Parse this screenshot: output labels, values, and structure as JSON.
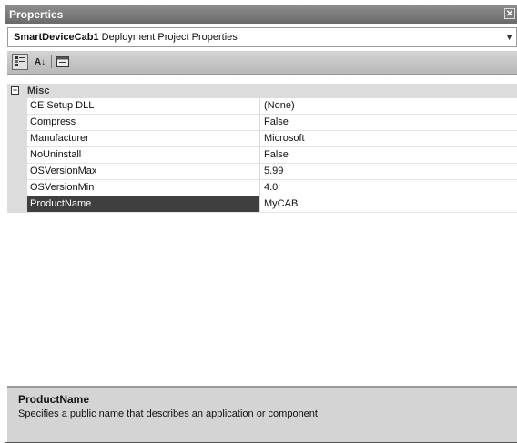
{
  "window": {
    "title": "Properties",
    "close_glyph": "✕"
  },
  "object_selector": {
    "name": "SmartDeviceCab1",
    "type": "Deployment Project Properties"
  },
  "toolbar": {
    "buttons": [
      {
        "id": "categorized",
        "icon": "categorized-icon"
      },
      {
        "id": "alphabetical",
        "icon": "sort-az-icon",
        "glyph": "A↓"
      },
      {
        "id": "property-pages",
        "icon": "property-pages-icon"
      }
    ]
  },
  "grid": {
    "category": {
      "label": "Misc",
      "toggle": "−"
    },
    "properties": [
      {
        "name": "CE Setup DLL",
        "value": "(None)"
      },
      {
        "name": "Compress",
        "value": "False"
      },
      {
        "name": "Manufacturer",
        "value": "Microsoft"
      },
      {
        "name": "NoUninstall",
        "value": "False"
      },
      {
        "name": "OSVersionMax",
        "value": "5.99"
      },
      {
        "name": "OSVersionMin",
        "value": "4.0"
      },
      {
        "name": "ProductName",
        "value": "MyCAB",
        "selected": true
      }
    ]
  },
  "description": {
    "title": "ProductName",
    "text": "Specifies a public name that describes an application or component"
  },
  "colors": {
    "titlebar": "#7a7a7a",
    "selected_row": "#3f3f3f",
    "category_bg": "#dcdcdc",
    "desc_bg": "#d4d4d4"
  }
}
